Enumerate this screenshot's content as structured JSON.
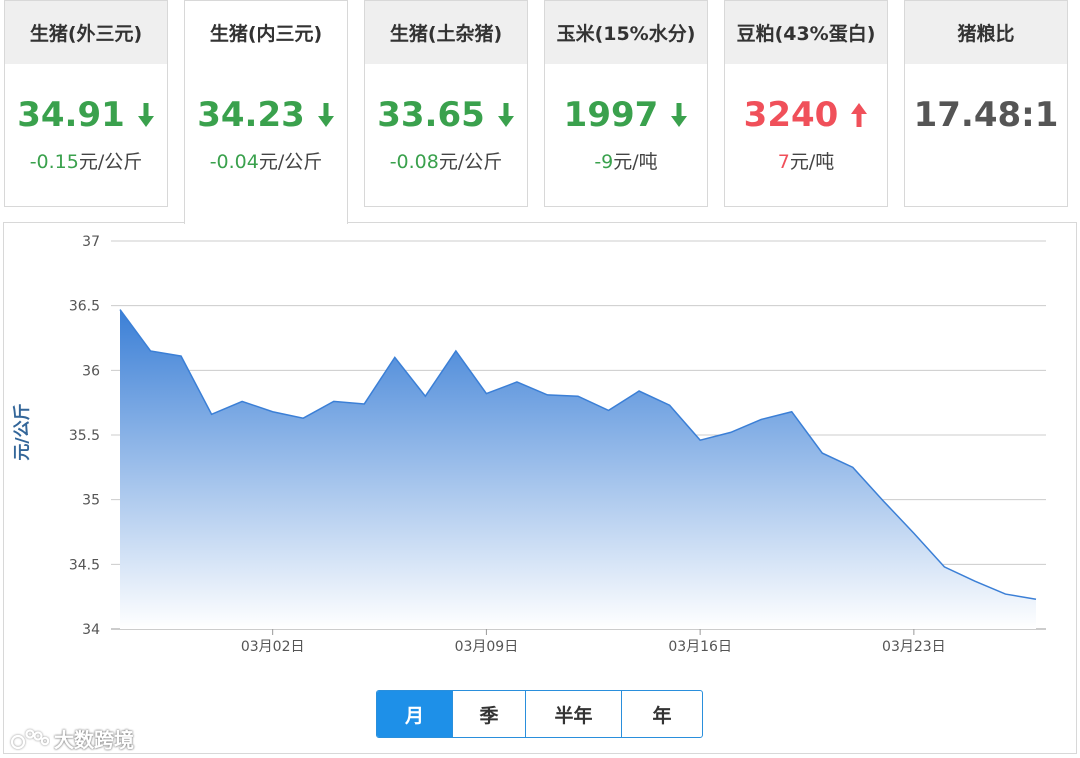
{
  "cards": [
    {
      "title": "生猪(外三元)",
      "value": "34.91",
      "change_num": "-0.15",
      "unit": "元/公斤",
      "trend": "down"
    },
    {
      "title": "生猪(内三元)",
      "value": "34.23",
      "change_num": "-0.04",
      "unit": "元/公斤",
      "trend": "down"
    },
    {
      "title": "生猪(土杂猪)",
      "value": "33.65",
      "change_num": "-0.08",
      "unit": "元/公斤",
      "trend": "down"
    },
    {
      "title": "玉米(15%水分)",
      "value": "1997",
      "change_num": "-9",
      "unit": "元/吨",
      "trend": "down"
    },
    {
      "title": "豆粕(43%蛋白)",
      "value": "3240",
      "change_num": "7",
      "unit": "元/吨",
      "trend": "up"
    },
    {
      "title": "猪粮比",
      "value": "17.48:1",
      "change_num": "",
      "unit": "",
      "trend": "none"
    }
  ],
  "active_card": 1,
  "colors": {
    "down": "#3aa14d",
    "up": "#f0505a",
    "accent": "#1e90e8",
    "area_top": "#3b7fd6",
    "area_bottom": "#ffffff",
    "line": "#3b7fd6",
    "grid": "#cccccc"
  },
  "range_buttons": [
    "月",
    "季",
    "半年",
    "年"
  ],
  "active_range": "月",
  "watermark": "大数跨境",
  "chart_data": {
    "type": "area",
    "ylabel": "元/公斤",
    "ylim": [
      34,
      37
    ],
    "yticks": [
      "37",
      "36.5",
      "36",
      "35.5",
      "35",
      "34.5",
      "34"
    ],
    "yticks_values": [
      37,
      36.5,
      36,
      35.5,
      35,
      34.5,
      34
    ],
    "xtick_labels": [
      "03月02日",
      "03月09日",
      "03月16日",
      "03月23日"
    ],
    "xtick_index": [
      5,
      12,
      19,
      26
    ],
    "x_days": [
      0,
      1,
      2,
      3,
      4,
      5,
      6,
      7,
      8,
      9,
      10,
      11,
      12,
      13,
      14,
      15,
      16,
      17,
      18,
      19,
      20,
      21,
      22,
      23,
      24,
      25,
      26,
      27,
      28,
      29,
      30
    ],
    "values": [
      36.47,
      36.15,
      36.11,
      35.66,
      35.76,
      35.68,
      35.63,
      35.76,
      35.74,
      36.1,
      35.8,
      36.15,
      35.82,
      35.91,
      35.81,
      35.8,
      35.69,
      35.84,
      35.73,
      35.46,
      35.52,
      35.62,
      35.68,
      35.36,
      35.25,
      34.99,
      34.74,
      34.48,
      34.37,
      34.27,
      34.23
    ],
    "grid": true,
    "legend": "none"
  }
}
